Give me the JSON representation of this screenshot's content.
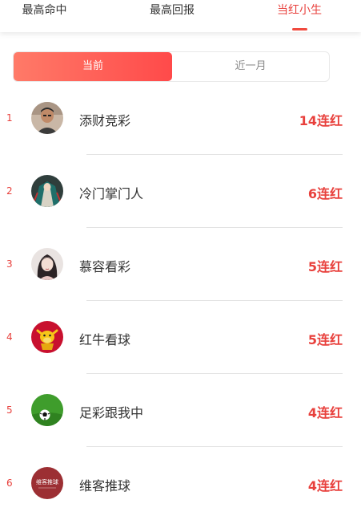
{
  "tabs": [
    {
      "label": "最高命中"
    },
    {
      "label": "最高回报"
    },
    {
      "label": "当红小生"
    }
  ],
  "period_toggle": {
    "current_label": "当前",
    "month_label": "近一月"
  },
  "colors": {
    "accent": "#e8403c",
    "gradient_start": "#ff7a68",
    "gradient_end": "#ff4a4a"
  },
  "rankings": [
    {
      "rank": "1",
      "name": "添财竞彩",
      "streak": "14连红",
      "avatar_icon": "man-portrait-avatar"
    },
    {
      "rank": "2",
      "name": "冷门掌门人",
      "streak": "6连红",
      "avatar_icon": "robed-figure-avatar"
    },
    {
      "rank": "3",
      "name": "慕容看彩",
      "streak": "5连红",
      "avatar_icon": "woman-portrait-avatar"
    },
    {
      "rank": "4",
      "name": "红牛看球",
      "streak": "5连红",
      "avatar_icon": "golden-ox-avatar"
    },
    {
      "rank": "5",
      "name": "足彩跟我中",
      "streak": "4连红",
      "avatar_icon": "soccer-ball-avatar"
    },
    {
      "rank": "6",
      "name": "维客推球",
      "streak": "4连红",
      "avatar_icon": "seal-logo-avatar",
      "avatar_text": "维客推球"
    }
  ]
}
